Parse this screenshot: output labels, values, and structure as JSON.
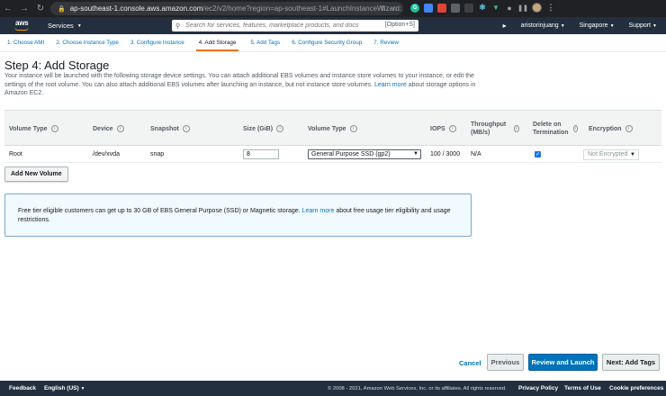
{
  "browser": {
    "url_host": "ap-southeast-1.console.aws.amazon.com",
    "url_path": "/ec2/v2/home?region=ap-southeast-1#LaunchInstanceWizard:"
  },
  "awsnav": {
    "logo": "aws",
    "services_label": "Services",
    "search_placeholder": "Search for services, features, marketplace products, and docs",
    "search_hint": "[Option+S]",
    "user": "aristorinjuang",
    "region": "Singapore",
    "support": "Support"
  },
  "steps": [
    {
      "label": "1. Choose AMI"
    },
    {
      "label": "2. Choose Instance Type"
    },
    {
      "label": "3. Configure Instance"
    },
    {
      "label": "4. Add Storage"
    },
    {
      "label": "5. Add Tags"
    },
    {
      "label": "6. Configure Security Group"
    },
    {
      "label": "7. Review"
    }
  ],
  "page": {
    "title": "Step 4: Add Storage",
    "desc_1": "Your instance will be launched with the following storage device settings. You can attach additional EBS volumes and instance store volumes to your instance, or edit the settings of the root volume. You can also attach additional EBS volumes after launching an instance, but not instance store volumes.",
    "desc_link": "Learn more",
    "desc_2": "about storage options in Amazon EC2."
  },
  "table": {
    "headers": {
      "volume_type": "Volume Type",
      "device": "Device",
      "snapshot": "Snapshot",
      "size": "Size (GiB)",
      "volume_type2": "Volume Type",
      "iops": "IOPS",
      "throughput": "Throughput (MB/s)",
      "delete_on_termination": "Delete on Termination",
      "encryption": "Encryption"
    },
    "rows": [
      {
        "volume_type": "Root",
        "device": "/dev/xvda",
        "snapshot": "snap",
        "size": "8",
        "ebs_type": "General Purpose SSD (gp2)",
        "iops": "100 / 3000",
        "throughput": "N/A",
        "delete_on_termination": true,
        "encryption": "Not Encrypted"
      }
    ]
  },
  "add_volume_label": "Add New Volume",
  "info": {
    "text_1": "Free tier eligible customers can get up to 30 GB of EBS General Purpose (SSD) or Magnetic storage.",
    "link": "Learn more",
    "text_2": "about free usage tier eligibility and usage restrictions."
  },
  "actions": {
    "cancel": "Cancel",
    "previous": "Previous",
    "review_launch": "Review and Launch",
    "next": "Next: Add Tags"
  },
  "footer": {
    "feedback": "Feedback",
    "language": "English (US)",
    "copyright": "© 2008 - 2021, Amazon Web Services, Inc. or its affiliates. All rights reserved.",
    "privacy": "Privacy Policy",
    "terms": "Terms of Use",
    "cookies": "Cookie preferences"
  },
  "colors": {
    "aws_nav": "#232f3e",
    "aws_orange": "#ff9900",
    "link_blue": "#0073bb",
    "primary_button": "#0073bb",
    "active_step_underline": "#ec7211"
  }
}
